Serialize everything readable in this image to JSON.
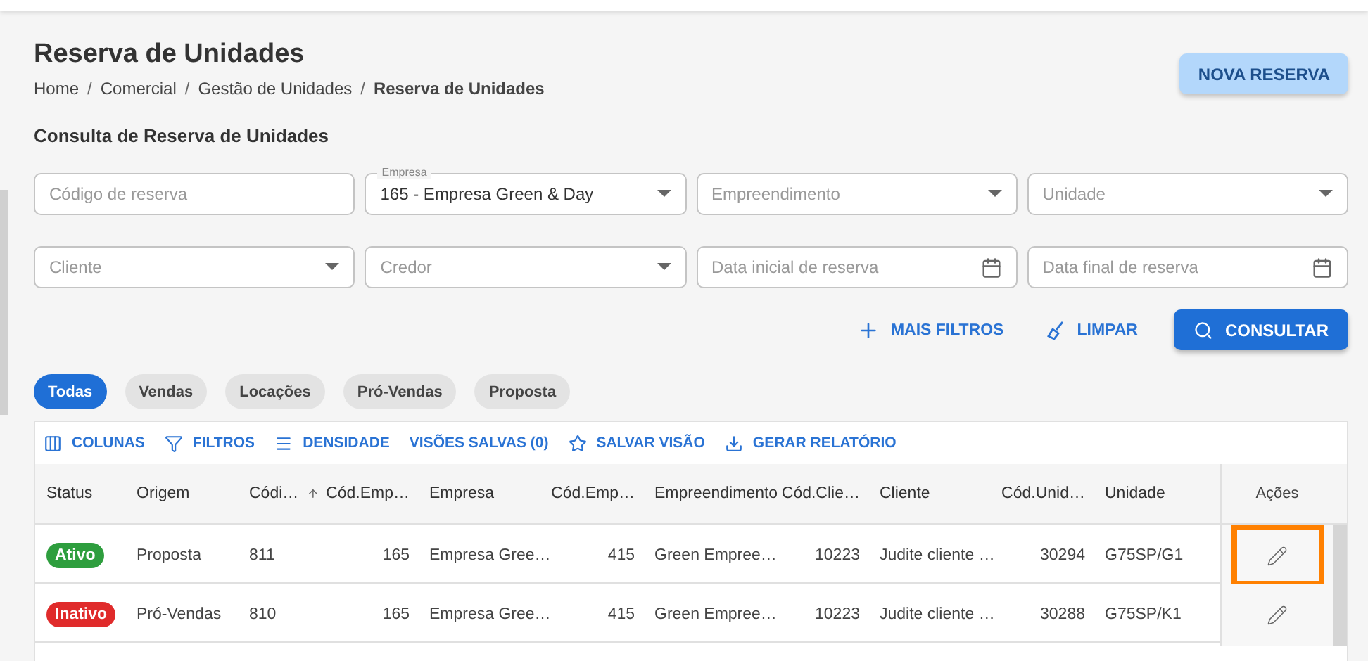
{
  "page": {
    "title": "Reserva de Unidades",
    "breadcrumb_separator": "/",
    "breadcrumb": [
      {
        "label": "Home",
        "current": false
      },
      {
        "label": "Comercial",
        "current": false
      },
      {
        "label": "Gestão de Unidades",
        "current": false
      },
      {
        "label": "Reserva de Unidades",
        "current": true
      }
    ],
    "primary_button": "NOVA RESERVA"
  },
  "search": {
    "title": "Consulta de Reserva de Unidades",
    "fields": [
      {
        "kind": "text",
        "placeholder": "Código de reserva"
      },
      {
        "kind": "select",
        "label": "Empresa",
        "value": "165 - Empresa Green & Day"
      },
      {
        "kind": "select",
        "placeholder": "Empreendimento"
      },
      {
        "kind": "select",
        "placeholder": "Unidade"
      },
      {
        "kind": "select",
        "placeholder": "Cliente"
      },
      {
        "kind": "select",
        "placeholder": "Credor"
      },
      {
        "kind": "date",
        "placeholder": "Data inicial de reserva"
      },
      {
        "kind": "date",
        "placeholder": "Data final de reserva"
      }
    ],
    "actions": [
      {
        "kind": "plus",
        "label": "MAIS FILTROS"
      },
      {
        "kind": "broom",
        "label": "LIMPAR"
      },
      {
        "kind": "search",
        "label": "CONSULTAR"
      }
    ]
  },
  "filter_chips": [
    {
      "label": "Todas",
      "selected": true
    },
    {
      "label": "Vendas",
      "selected": false
    },
    {
      "label": "Locações",
      "selected": false
    },
    {
      "label": "Pró-Vendas",
      "selected": false
    },
    {
      "label": "Proposta",
      "selected": false
    }
  ],
  "table": {
    "toolbar": [
      {
        "kind": "columns",
        "label": "COLUNAS"
      },
      {
        "kind": "filter",
        "label": "FILTROS"
      },
      {
        "kind": "density",
        "label": "DENSIDADE"
      },
      {
        "kind": "none",
        "label": "VISÕES SALVAS (0)"
      },
      {
        "kind": "star",
        "label": "SALVAR VISÃO"
      },
      {
        "kind": "download",
        "label": "GERAR RELATÓRIO"
      }
    ],
    "columns": [
      {
        "label": "Status",
        "sorted": false
      },
      {
        "label": "Origem",
        "sorted": false
      },
      {
        "label": "Códi…",
        "sorted": true
      },
      {
        "label": "Cód.Emp…",
        "sorted": false
      },
      {
        "label": "Empresa",
        "sorted": false
      },
      {
        "label": "Cód.Emp…",
        "sorted": false
      },
      {
        "label": "Empreendimento",
        "sorted": false
      },
      {
        "label": "Cód.Clie…",
        "sorted": false
      },
      {
        "label": "Cliente",
        "sorted": false
      },
      {
        "label": "Cód.Unid…",
        "sorted": false
      },
      {
        "label": "Unidade",
        "sorted": false
      }
    ],
    "actions_column": "Ações",
    "rows": [
      {
        "color": "#2e9e3e",
        "cells": [
          "Ativo",
          "Proposta",
          "811",
          "165",
          "Empresa Gree…",
          "415",
          "Green Empree…",
          "10223",
          "Judite cliente …",
          "30294",
          "G75SP/G1"
        ],
        "highlighted": true
      },
      {
        "color": "#e02b2b",
        "cells": [
          "Inativo",
          "Pró-Vendas",
          "810",
          "165",
          "Empresa Gree…",
          "415",
          "Green Empree…",
          "10223",
          "Judite cliente …",
          "30288",
          "G75SP/K1"
        ],
        "highlighted": false
      }
    ]
  }
}
